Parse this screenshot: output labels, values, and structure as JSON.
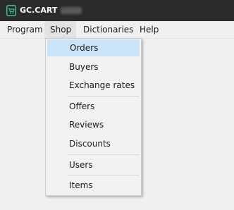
{
  "window": {
    "title": "GC.CART",
    "title_suffix_blurred": true,
    "icon": "cart-icon",
    "titlebar_color": "#2b2b2b",
    "icon_color": "#3dbf8a"
  },
  "menubar": {
    "items": [
      {
        "label": "Program"
      },
      {
        "label": "Shop",
        "active": true
      },
      {
        "label": "Dictionaries"
      },
      {
        "label": "Help"
      }
    ]
  },
  "shop_menu": {
    "highlight_color": "#cce4f7",
    "groups": [
      [
        {
          "label": "Orders",
          "highlighted": true
        },
        {
          "label": "Buyers"
        },
        {
          "label": "Exchange rates"
        }
      ],
      [
        {
          "label": "Offers"
        },
        {
          "label": "Reviews"
        },
        {
          "label": "Discounts"
        }
      ],
      [
        {
          "label": "Users"
        }
      ],
      [
        {
          "label": "Items"
        }
      ]
    ]
  }
}
